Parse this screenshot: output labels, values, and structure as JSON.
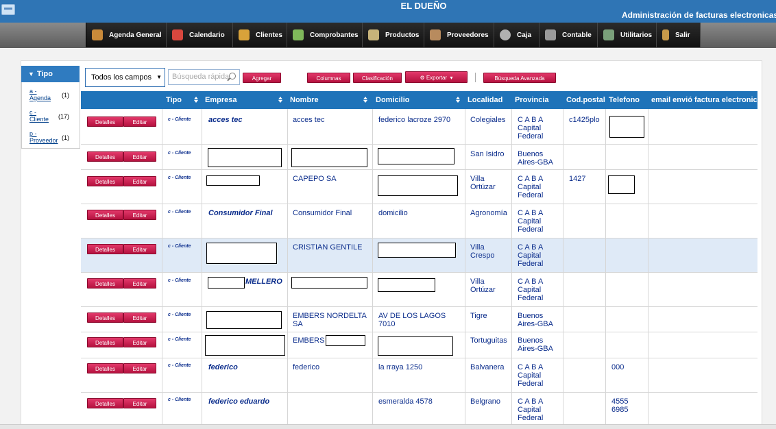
{
  "header": {
    "title": "EL DUEÑO",
    "subtitle": "Administración de facturas electronicas"
  },
  "menu": [
    {
      "label": "Agenda General",
      "icon": "address-book-icon",
      "color": "#c98a3a"
    },
    {
      "label": "Calendario",
      "icon": "calendar-icon",
      "color": "#d8473e"
    },
    {
      "label": "Clientes",
      "icon": "clients-icon",
      "color": "#d8a23a"
    },
    {
      "label": "Comprobantes",
      "icon": "receipt-icon",
      "color": "#7fb85a"
    },
    {
      "label": "Productos",
      "icon": "products-icon",
      "color": "#c7b37a"
    },
    {
      "label": "Proveedores",
      "icon": "supplier-icon",
      "color": "#b88b5e"
    },
    {
      "label": "Caja",
      "icon": "cash-icon",
      "color": "#b0b0b0"
    },
    {
      "label": "Contable",
      "icon": "accounting-icon",
      "color": "#9a9a9a"
    },
    {
      "label": "Utilitarios",
      "icon": "utilities-icon",
      "color": "#7aa07a"
    },
    {
      "label": "Salir",
      "icon": "exit-icon",
      "color": "#c89a4a"
    }
  ],
  "sidebar": {
    "title": "Tipo",
    "items": [
      {
        "label_a": "a -",
        "label_b": "Agenda",
        "count": "(1)"
      },
      {
        "label_a": "c -",
        "label_b": "Cliente",
        "count": "(17)"
      },
      {
        "label_a": "p -",
        "label_b": "Proveedor",
        "count": "(1)"
      }
    ]
  },
  "toolbar": {
    "field_select": "Todos los campos",
    "search_placeholder": "Búsqueda rápida",
    "add": "Agregar",
    "columns": "Columnas",
    "sort": "Clasificación",
    "export": "Exportar",
    "advanced": "Búsqueda Avanzada"
  },
  "table": {
    "headers": {
      "tipo": "Tipo",
      "empresa": "Empresa",
      "nombre": "Nombre",
      "domicilio": "Domicilio",
      "localidad": "Localidad",
      "provincia": "Provincia",
      "cp": "Cod.postal",
      "telefono": "Telefono",
      "email": "email envió factura electronica"
    },
    "details_label": "Detalles",
    "edit_label": "Editar",
    "rows": [
      {
        "tipo": "c - Cliente",
        "empresa": "acces tec",
        "nombre": "acces tec",
        "domicilio": "federico lacroze 2970",
        "localidad": "Colegiales",
        "provincia": "C A B A Capital Federal",
        "cp": "c1425plo",
        "telefono": ""
      },
      {
        "tipo": "c - Cliente",
        "empresa": "",
        "nombre": "",
        "domicilio": "",
        "localidad": "San Isidro",
        "provincia": "Buenos Aires-GBA",
        "cp": "",
        "telefono": ""
      },
      {
        "tipo": "c - Cliente",
        "empresa": "",
        "nombre": "CAPEPO SA",
        "domicilio": "",
        "localidad": "Villa Ortúzar",
        "provincia": "C A B A Capital Federal",
        "cp": "1427",
        "telefono": ""
      },
      {
        "tipo": "c - Cliente",
        "empresa": "Consumidor Final",
        "nombre": "Consumidor Final",
        "domicilio": "domicilio",
        "localidad": "Agronomía",
        "provincia": "C A B A Capital Federal",
        "cp": "",
        "telefono": ""
      },
      {
        "tipo": "c - Cliente",
        "empresa": "",
        "nombre": "CRISTIAN GENTILE",
        "domicilio": "",
        "localidad": "Villa Crespo",
        "provincia": "C A B A Capital Federal",
        "cp": "",
        "telefono": ""
      },
      {
        "tipo": "c - Cliente",
        "empresa": "MELLERO",
        "nombre": "",
        "domicilio": "",
        "localidad": "Villa Ortúzar",
        "provincia": "C A B A Capital Federal",
        "cp": "",
        "telefono": ""
      },
      {
        "tipo": "c - Cliente",
        "empresa": "",
        "nombre": "EMBERS NORDELTA SA",
        "domicilio": "AV DE LOS LAGOS 7010",
        "localidad": "Tigre",
        "provincia": "Buenos Aires-GBA",
        "cp": "",
        "telefono": ""
      },
      {
        "tipo": "c - Cliente",
        "empresa": "",
        "nombre": "EMBERS SA",
        "domicilio": "",
        "localidad": "Tortuguitas",
        "provincia": "Buenos Aires-GBA",
        "cp": "",
        "telefono": ""
      },
      {
        "tipo": "c - Cliente",
        "empresa": "federico",
        "nombre": "federico",
        "domicilio": "la rraya 1250",
        "localidad": "Balvanera",
        "provincia": "C A B A Capital Federal",
        "cp": "",
        "telefono": "000"
      },
      {
        "tipo": "c - Cliente",
        "empresa": "federico eduardo",
        "nombre": "",
        "domicilio": "esmeralda 4578",
        "localidad": "Belgrano",
        "provincia": "C A B A Capital Federal",
        "cp": "",
        "telefono": "4555 6985"
      }
    ]
  }
}
